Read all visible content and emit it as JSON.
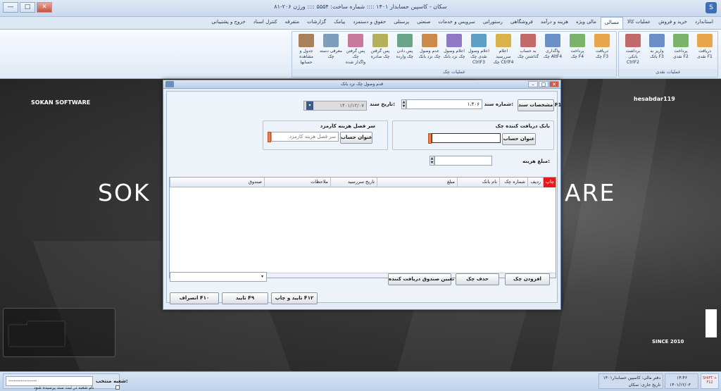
{
  "window": {
    "title": "سکان - کاسپین حسابدار ۱۴۰۱ :::: شماره ساخت: ۵۵۵۴ :::: ورژن ۲۰۶-۸۱",
    "min": "—",
    "max": "□",
    "close": "✕",
    "app_icon": "S"
  },
  "menu": [
    "استاندارد",
    "خرید و فروش",
    "عملیات کالا",
    "مسالی",
    "مالی ویژه",
    "هزینه و درآمد",
    "فروشگاهی",
    "رستورانی",
    "سرویس و خدمات",
    "صنعتی",
    "پرسنلی",
    "حقوق و دستمزد",
    "پیامک",
    "گزارشات",
    "متفرقه",
    "کنترل اسناد",
    "خروج و پشتیبانی"
  ],
  "active_menu": "مسالی",
  "ribbon": {
    "group_cash": "عملیات نقدی",
    "group_check": "عملیات چک",
    "cash_buttons": [
      "دریافت\nنقدی F1",
      "پرداخت\nنقدی F2",
      "واریز به\nبانک F3",
      "برداشت\nبانکی CtrlF2"
    ],
    "check_buttons": [
      "دریافت\nچک F3",
      "پرداخت\nچک F4",
      "واگذاری\nچک AltF4",
      "به حساب\nگذاشتن چک",
      "اعلام سررسید\nچک CtrlF4",
      "اعلام وصول\nنقدی چک CtrlF3",
      "اعلام وصول\nچک نزد بانک",
      "عدم وصول\nچک نزد بانک",
      "پس دادن\nچک وارده",
      "پس گرفتن\nچک صادره",
      "پس گرفتن چک\nواگذار شده",
      "معرفی دسته\nچک",
      "جدول و مشاهده\nحسابها"
    ]
  },
  "background": {
    "left_brand": "SOKAN SOFTWARE",
    "right_user": "hesabdar119",
    "big_left": "SOK",
    "big_right": "ARE",
    "since": "SINCE 2010"
  },
  "dialog": {
    "title": "قدم وصول چک نزد بانک",
    "doc_spec_btn": "مشخصات سند F1",
    "doc_number_label": "شماره سند:",
    "doc_number": "۱،۴۰۶",
    "doc_date_label": "تاریخ سند:",
    "doc_date": "۱۴۰۱/۱۲/۰۷",
    "bank_group": "بانک دریافت کننده چک",
    "account_btn_1": "عنوان حساب",
    "fee_group": "سر فصل هزینه کارمزد",
    "account_btn_2": "عنوان حساب",
    "fee_placeholder": "سر فصل هزینه کارمزد",
    "fee_amount_label": "مبلغ هزینه:",
    "columns": [
      "چاپ",
      "ردیف",
      "شماره چک",
      "نام بانک",
      "مبلغ",
      "تاریخ سررسید",
      "ملاحظات",
      "صندوق"
    ],
    "add_btn": "افزودن چک",
    "delete_btn": "حذف چک",
    "fund_btn": "تعیین صندوق دریافت کننده",
    "confirm_print_btn": "تایید و چاپ F۱۲",
    "confirm_btn": "تایید F۹",
    "cancel_btn": "انصراف F۱۰"
  },
  "status": {
    "branch_label": "شعبه منتخب:",
    "branch_value": "----------------",
    "branch_check": "نام شعبه در ثبت سند پرسیده شود",
    "book": "دفتر مالی: کاسپین حسابدار۱۴۰۱",
    "current_date": "تاریخ جاری: سکان",
    "clock": "۱۴:۴۶",
    "date": "۱۴۰۱/۱۲/۰۳",
    "shift": "SHIFT + F12"
  },
  "colors": {
    "accent": "#3e6fb4",
    "red_header": "#e11c1c",
    "orange": "#ef7e4b"
  }
}
